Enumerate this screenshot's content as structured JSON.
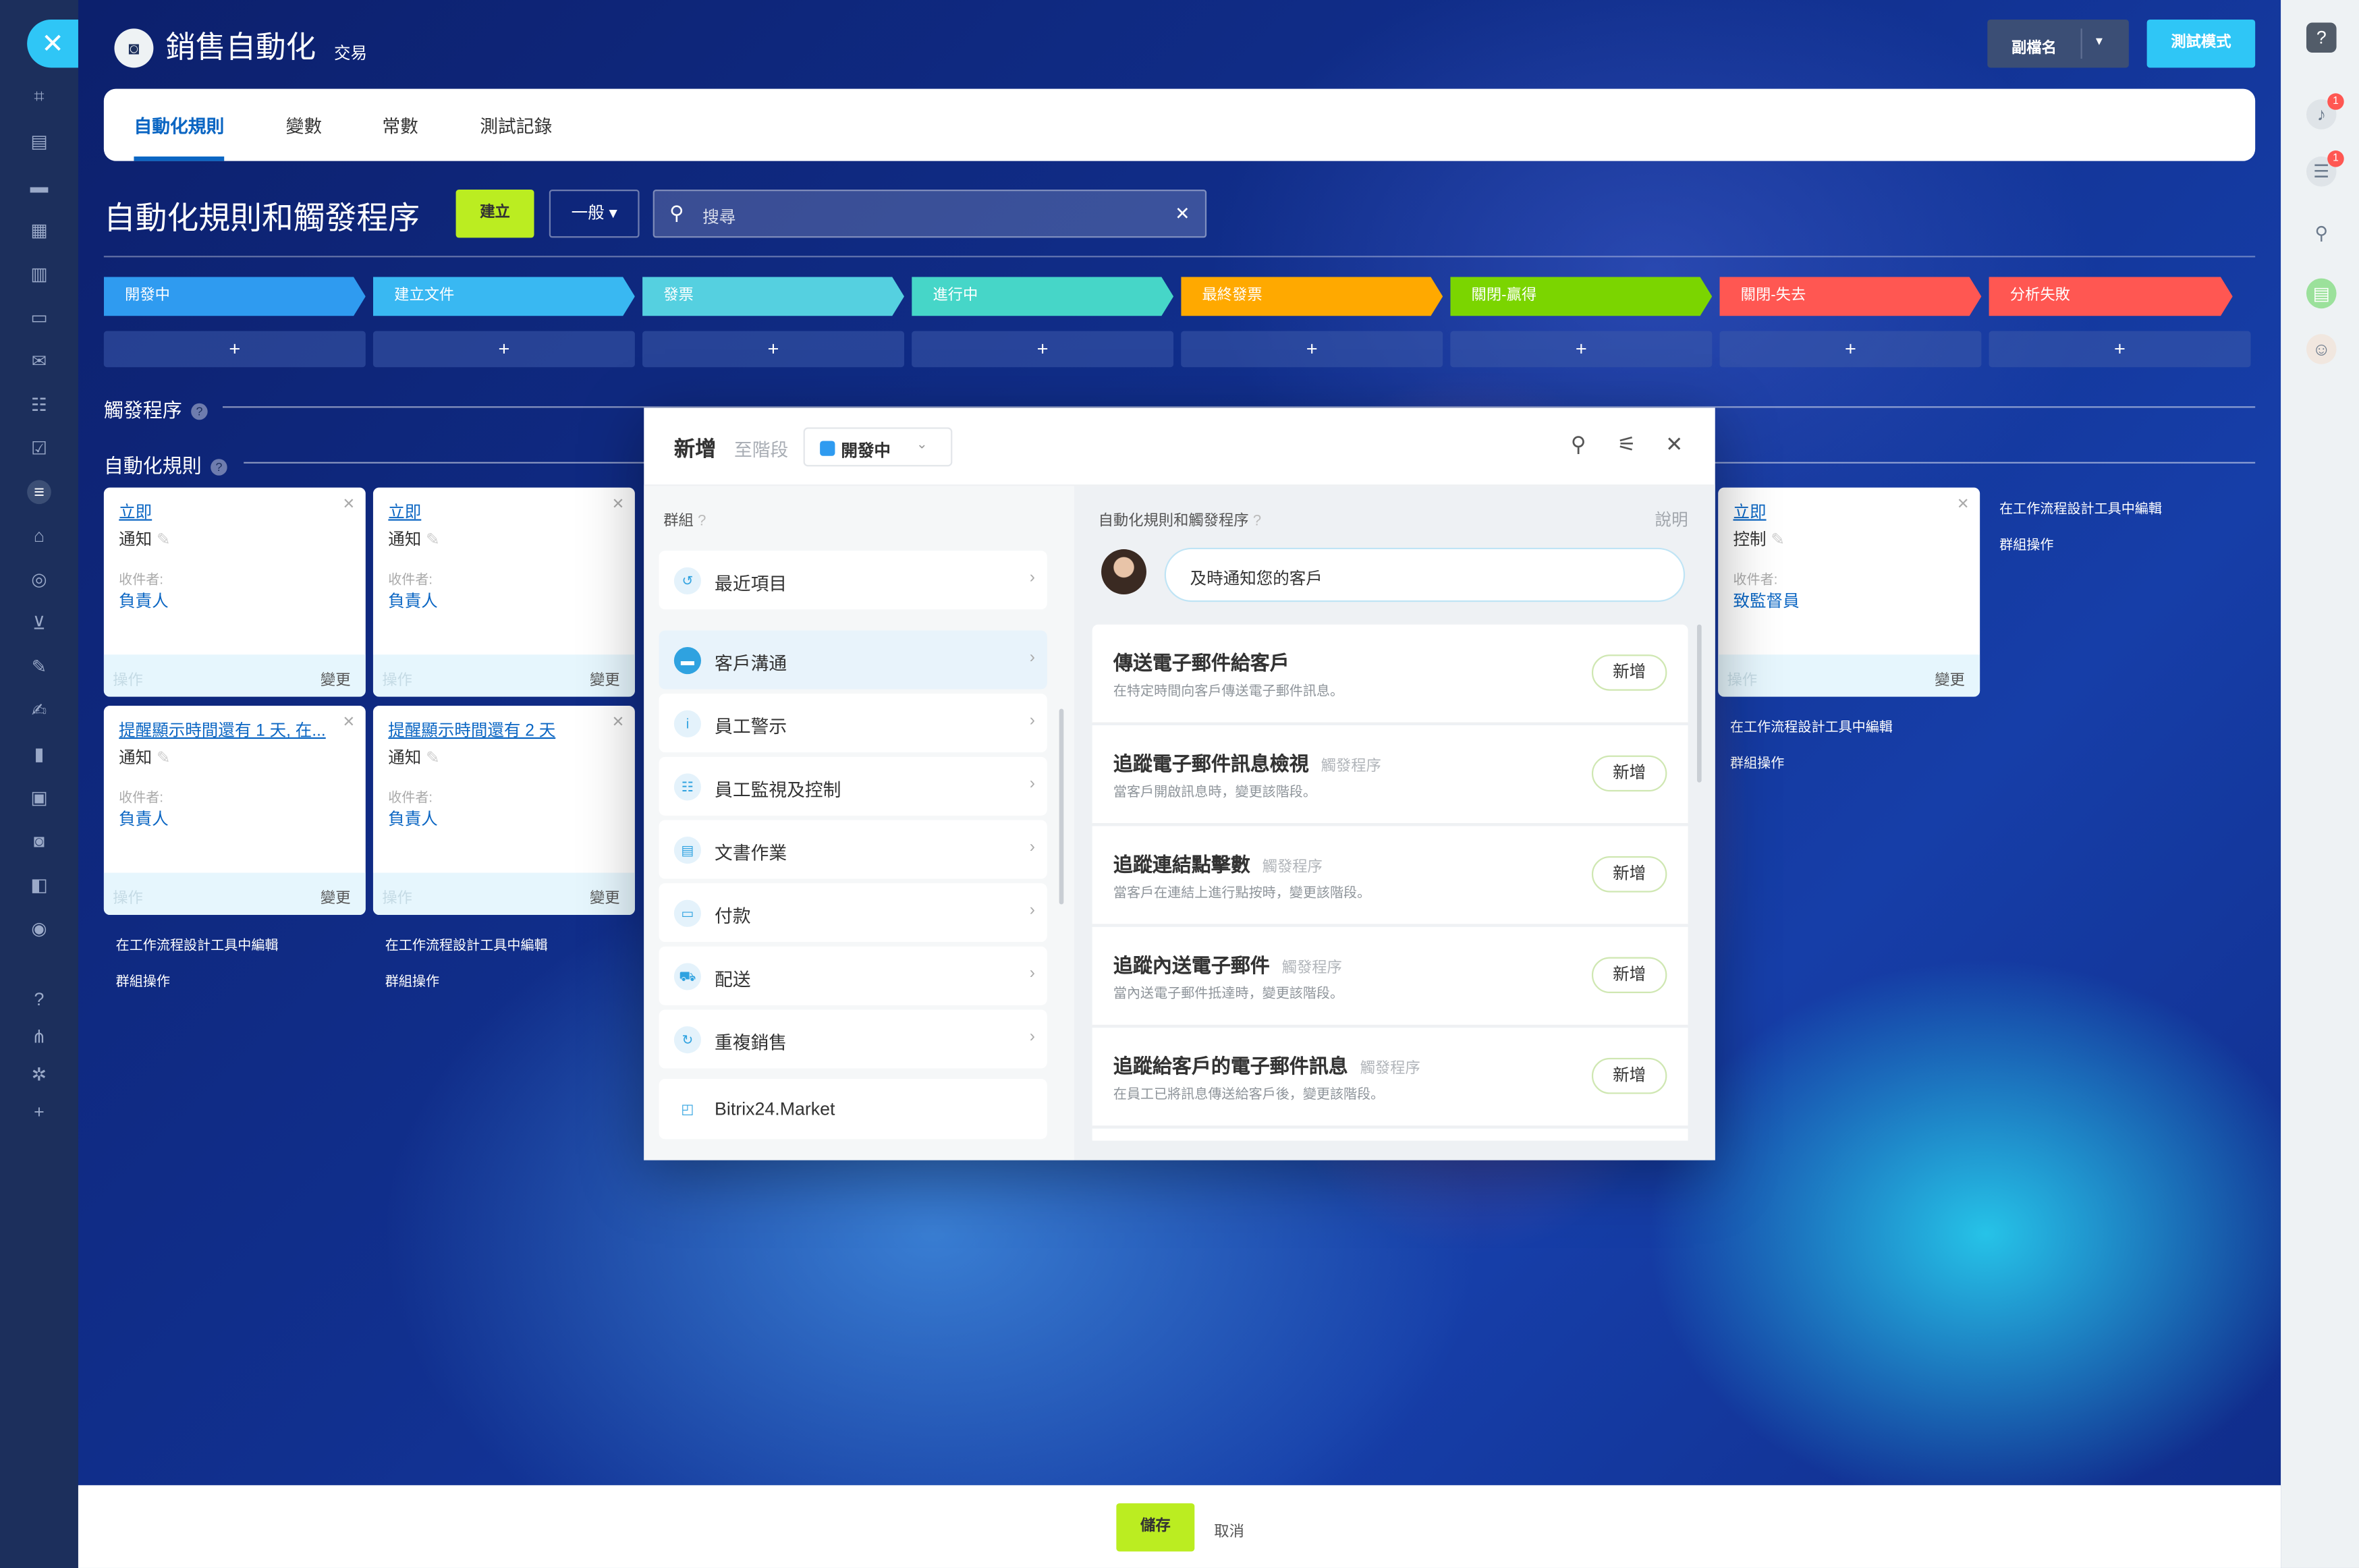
{
  "app": {
    "title": "銷售自動化",
    "subtitle": "交易"
  },
  "header": {
    "sub_label": "副檔名",
    "test_label": "測試模式"
  },
  "tabs": [
    "自動化規則",
    "變數",
    "常數",
    "測試記錄"
  ],
  "page": {
    "title": "自動化規則和觸發程序",
    "create_label": "建立",
    "filter_label": "一般",
    "search_placeholder": "搜尋"
  },
  "stages": [
    {
      "label": "開發中",
      "color": "#2f9bf0"
    },
    {
      "label": "建立文件",
      "color": "#39b8f2"
    },
    {
      "label": "發票",
      "color": "#55d0e0"
    },
    {
      "label": "進行中",
      "color": "#46d6c8"
    },
    {
      "label": "最終發票",
      "color": "#ffa900"
    },
    {
      "label": "關閉-贏得",
      "color": "#7bd500"
    },
    {
      "label": "關閉-失去",
      "color": "#ff5752"
    },
    {
      "label": "分析失敗",
      "color": "#ff5752"
    }
  ],
  "plus_label": "+",
  "sections": {
    "triggers": "觸發程序",
    "rules": "自動化規則",
    "help_glyph": "?"
  },
  "cards": [
    {
      "title": "立即",
      "kind": "通知",
      "recipient_label": "收件者:",
      "recipient": "負責人",
      "op": "操作",
      "change": "變更"
    },
    {
      "title": "立即",
      "kind": "通知",
      "recipient_label": "收件者:",
      "recipient": "負責人",
      "op": "操作",
      "change": "變更"
    },
    {
      "title": "提醒顯示時間還有 1 天, 在...",
      "kind": "通知",
      "recipient_label": "收件者:",
      "recipient": "負責人",
      "op": "操作",
      "change": "變更"
    },
    {
      "title": "提醒顯示時間還有 2 天",
      "kind": "通知",
      "recipient_label": "收件者:",
      "recipient": "負責人",
      "op": "操作",
      "change": "變更"
    },
    {
      "title": "立即",
      "kind": "控制",
      "recipient_label": "收件者:",
      "recipient": "致監督員",
      "op": "操作",
      "change": "變更"
    }
  ],
  "links": {
    "designer": "在工作流程設計工具中編輯",
    "group": "群組操作"
  },
  "modal": {
    "new_label": "新增",
    "to_stage": "至階段",
    "stage": "開發中",
    "groups_label": "群組",
    "groups": [
      "最近項目",
      "客戶溝通",
      "員工警示",
      "員工監視及控制",
      "文書作業",
      "付款",
      "配送",
      "重複銷售"
    ],
    "market": "Bitrix24.Market",
    "rules_label": "自動化規則和觸發程序",
    "help": "說明",
    "bubble": "及時通知您的客戶",
    "items": [
      {
        "title": "傳送電子郵件給客戶",
        "tag": "",
        "desc": "在特定時間向客戶傳送電子郵件訊息。",
        "btn": "新增"
      },
      {
        "title": "追蹤電子郵件訊息檢視",
        "tag": "觸發程序",
        "desc": "當客戶開啟訊息時，變更該階段。",
        "btn": "新增"
      },
      {
        "title": "追蹤連結點擊數",
        "tag": "觸發程序",
        "desc": "當客戶在連結上進行點按時，變更該階段。",
        "btn": "新增"
      },
      {
        "title": "追蹤內送電子郵件",
        "tag": "觸發程序",
        "desc": "當內送電子郵件抵達時，變更該階段。",
        "btn": "新增"
      },
      {
        "title": "追蹤給客戶的電子郵件訊息",
        "tag": "觸發程序",
        "desc": "在員工已將訊息傳送給客戶後，變更該階段。",
        "btn": "新增"
      }
    ]
  },
  "footer": {
    "save": "儲存",
    "cancel": "取消"
  },
  "right_badges": [
    "1",
    "1"
  ]
}
